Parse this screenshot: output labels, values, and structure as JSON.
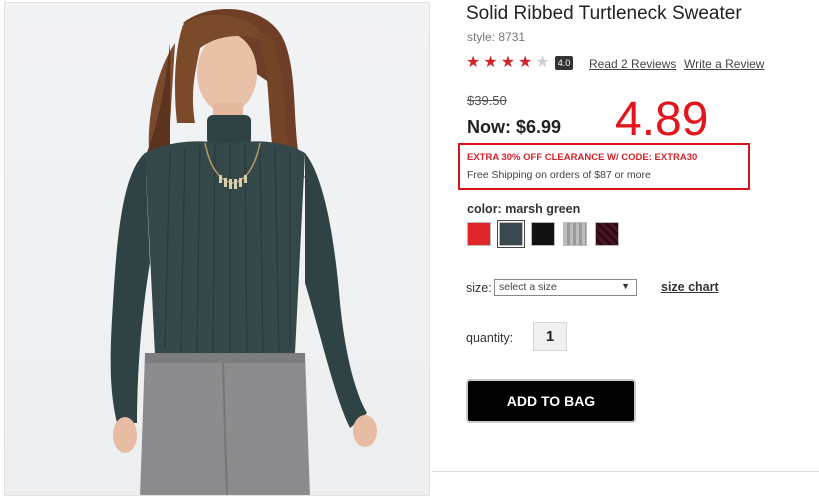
{
  "product": {
    "title": "Solid Ribbed Turtleneck Sweater",
    "style": "style: 8731",
    "rating_value": "4.0",
    "stars_filled": 4,
    "stars_total": 5,
    "read_reviews": "Read 2 Reviews",
    "write_review": "Write a Review"
  },
  "price": {
    "original": "$39.50",
    "now_label": "Now:",
    "now_value": "$6.99",
    "handwritten_note": "4.89"
  },
  "promo": {
    "line": "EXTRA 30% OFF CLEARANCE W/ CODE: EXTRA30",
    "shipping": "Free Shipping on orders of $87 or more"
  },
  "color": {
    "label": "color:",
    "selected": "marsh green",
    "swatches": [
      {
        "name": "red",
        "hex": "#e0262a"
      },
      {
        "name": "marsh green",
        "hex": "#3b4a4e"
      },
      {
        "name": "black",
        "hex": "#111111"
      },
      {
        "name": "gray",
        "hex": "#a9a9a9"
      },
      {
        "name": "burgundy",
        "hex": "#4a1420"
      }
    ]
  },
  "size": {
    "label": "size:",
    "placeholder": "select a size",
    "chart_link": "size chart"
  },
  "quantity": {
    "label": "quantity:",
    "value": "1"
  },
  "cart": {
    "add_label": "ADD TO BAG"
  },
  "colors": {
    "accent_red": "#d2232a",
    "button_bg": "#000000",
    "annotation_red": "#e3141b"
  }
}
